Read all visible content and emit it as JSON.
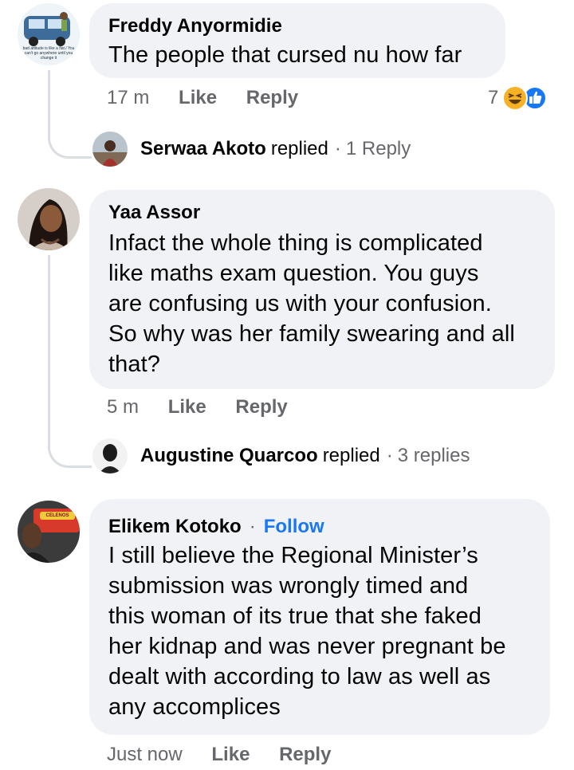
{
  "comments": [
    {
      "author": "Freddy Anyormidie",
      "text": "The people that cursed nu how far",
      "time": "17 m",
      "like_label": "Like",
      "reply_label": "Reply",
      "reaction_count": "7",
      "reactions": [
        "haha-icon",
        "like-icon"
      ],
      "avatar_caption": "bad attitude is like a flat / You can't go anywhere until you change it",
      "replied": {
        "name": "Serwaa Akoto",
        "verb": "replied",
        "sep": "·",
        "count": "1 Reply"
      }
    },
    {
      "author": "Yaa Assor",
      "lines": [
        "Infact the whole thing is complicated",
        "like maths exam question. You guys",
        "are confusing us with your confusion.",
        "So why was her family swearing and all",
        "that?"
      ],
      "time": "5 m",
      "like_label": "Like",
      "reply_label": "Reply",
      "replied": {
        "name": "Augustine Quarcoo",
        "verb": "replied",
        "sep": "·",
        "count": "3 replies"
      }
    },
    {
      "author": "Elikem Kotoko",
      "sep": "·",
      "follow_label": "Follow",
      "lines": [
        "I still believe the Regional Minister’s",
        "submission was wrongly timed and",
        "this woman of its true that she faked",
        "her kidnap and was never pregnant be",
        "dealt with according to law as well as",
        "any accomplices"
      ],
      "time": "Just now",
      "like_label": "Like",
      "reply_label": "Reply",
      "avatar_caption": "CELENOS"
    }
  ],
  "colors": {
    "bubble": "#f0f2f5",
    "meta": "#65676b",
    "link": "#1877f2",
    "like_blue": "#1877f2",
    "haha_yellow": "#f7b125"
  }
}
